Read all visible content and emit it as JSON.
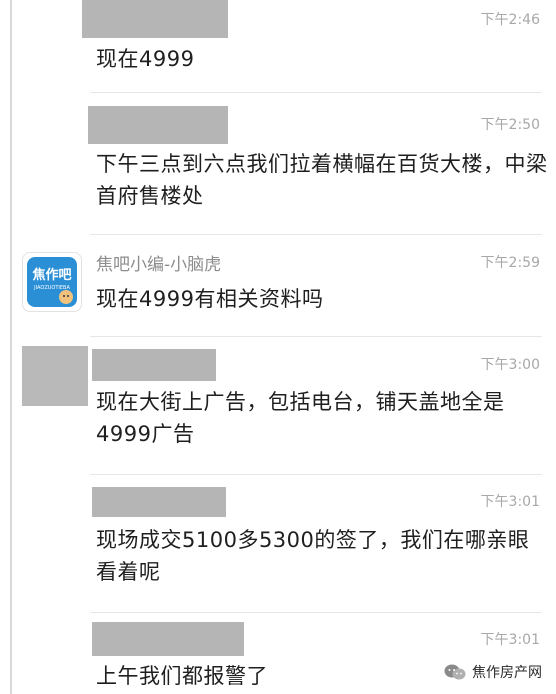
{
  "messages": [
    {
      "time": "下午2:46",
      "text": "现在4999"
    },
    {
      "time": "下午2:50",
      "text": "下午三点到六点我们拉着横幅在百货大楼，中梁首府售楼处"
    },
    {
      "sender": "焦吧小编-小脑虎",
      "time": "下午2:59",
      "text": "现在4999有相关资料吗",
      "avatar": {
        "brand": "焦作吧",
        "subtitle": "JIAOZUOTIEBA",
        "brand_color": "#2b8fd6"
      }
    },
    {
      "time": "下午3:00",
      "text": "现在大街上广告，包括电台，铺天盖地全是4999广告"
    },
    {
      "time": "下午3:01",
      "text": "现场成交5100多5300的签了，我们在哪亲眼看着呢"
    },
    {
      "time": "下午3:01",
      "text": "上午我们都报警了"
    }
  ],
  "watermark": {
    "label": "焦作房产网",
    "icon": "wechat-icon"
  }
}
